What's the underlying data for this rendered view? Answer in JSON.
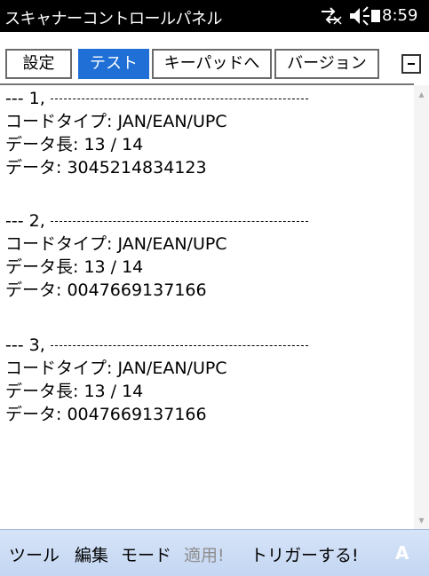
{
  "window": {
    "title": "スキャナーコントロールパネル",
    "clock": "8:59"
  },
  "tabs": [
    {
      "label": "設定",
      "active": false
    },
    {
      "label": "テスト",
      "active": true
    },
    {
      "label": "キーパッドへ",
      "active": false
    },
    {
      "label": "バージョン",
      "active": false
    }
  ],
  "entries": [
    {
      "index": "--- 1,",
      "code_type": "コードタイプ: JAN/EAN/UPC",
      "data_length": "データ長: 13 / 14",
      "data": "データ: 3045214834123"
    },
    {
      "index": "--- 2,",
      "code_type": "コードタイプ: JAN/EAN/UPC",
      "data_length": "データ長: 13 / 14",
      "data": "データ: 0047669137166"
    },
    {
      "index": "--- 3,",
      "code_type": "コードタイプ: JAN/EAN/UPC",
      "data_length": "データ長: 13 / 14",
      "data": "データ: 0047669137166"
    }
  ],
  "menu": {
    "tools": "ツール",
    "edit": "編集",
    "mode": "モード",
    "apply": "適用!",
    "trigger": "トリガーする!",
    "ime": "A"
  },
  "icons": {
    "connectivity": "connectivity-icon",
    "volume": "speaker-icon",
    "battery": "battery-icon",
    "minimize": "minimize-icon"
  },
  "colors": {
    "title_bg": "#000000",
    "active_tab": "#1f6fd6",
    "menubar": "#c4d6f2"
  }
}
